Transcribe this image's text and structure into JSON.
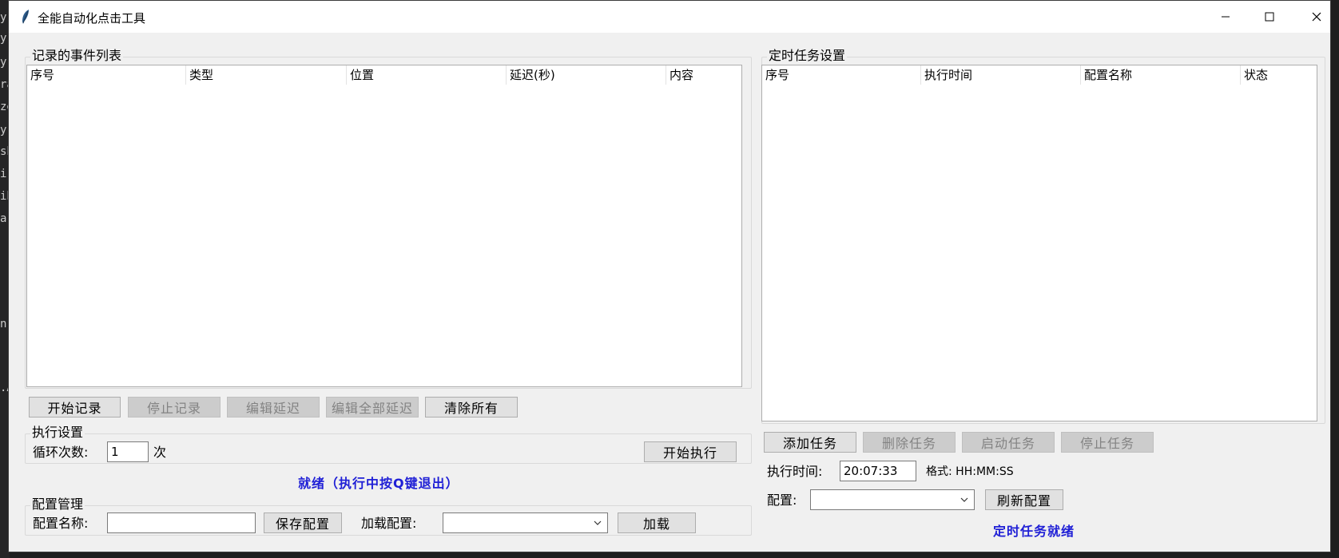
{
  "background": {
    "left_fragments": [
      "y",
      "y",
      "y",
      "ra",
      "ze",
      "y",
      "sh",
      "i.t",
      "ib",
      "a",
      "n",
      ".A"
    ]
  },
  "window": {
    "title": "全能自动化点击工具",
    "icon": "feather-icon",
    "controls": [
      "minimize-icon",
      "maximize-icon",
      "close-icon"
    ]
  },
  "events": {
    "group_title": "记录的事件列表",
    "columns": [
      "序号",
      "类型",
      "位置",
      "延迟(秒)",
      "内容"
    ],
    "rows": [],
    "buttons": {
      "start_record": "开始记录",
      "stop_record": "停止记录",
      "edit_delay": "编辑延迟",
      "edit_all_delay": "编辑全部延迟",
      "clear_all": "清除所有"
    }
  },
  "execution": {
    "group_title": "执行设置",
    "loop_label": "循环次数:",
    "loop_value": "1",
    "loop_unit": "次",
    "start_button": "开始执行",
    "status": "就绪（执行中按Q键退出）"
  },
  "config": {
    "group_title": "配置管理",
    "name_label": "配置名称:",
    "name_value": "",
    "save_button": "保存配置",
    "load_label": "加载配置:",
    "load_selected": "",
    "load_button": "加载"
  },
  "schedule": {
    "group_title": "定时任务设置",
    "columns": [
      "序号",
      "执行时间",
      "配置名称",
      "状态"
    ],
    "rows": [],
    "buttons": {
      "add": "添加任务",
      "delete": "删除任务",
      "start": "启动任务",
      "stop": "停止任务"
    },
    "time_label": "执行时间:",
    "time_value": "20:07:33",
    "format_label": "格式: HH:MM:SS",
    "config_label": "配置:",
    "config_selected": "",
    "refresh_button": "刷新配置",
    "status": "定时任务就绪"
  },
  "colors": {
    "window_bg": "#f0f0f0",
    "status_blue": "#1f1fd6",
    "disabled_text": "#838383"
  }
}
